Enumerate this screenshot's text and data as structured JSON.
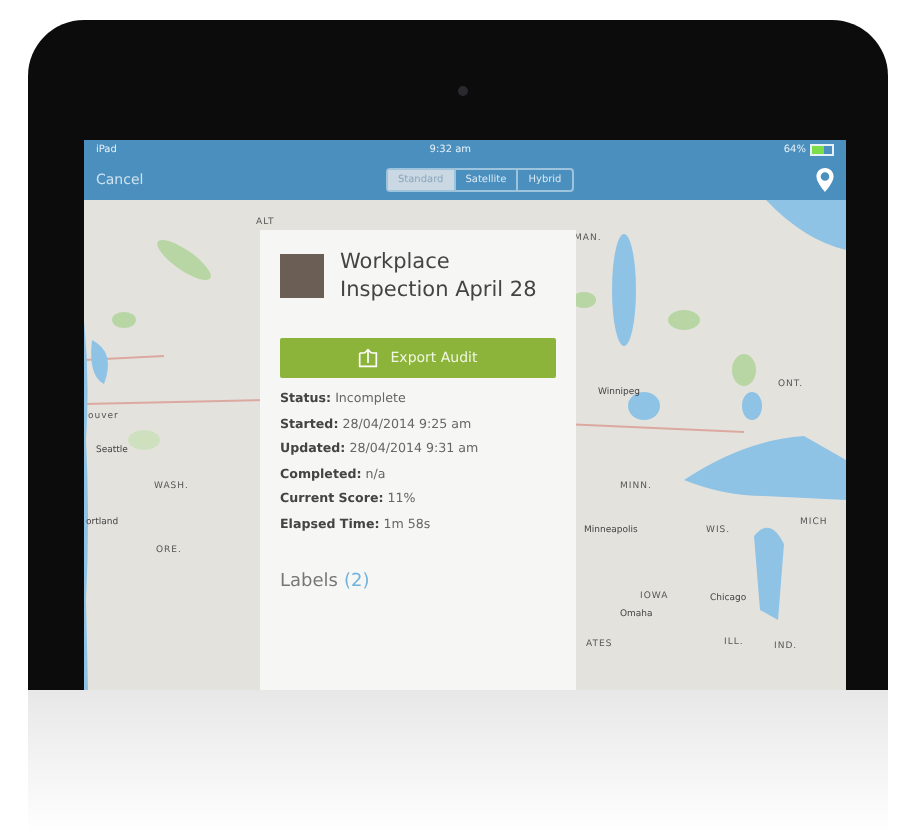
{
  "status_bar": {
    "device": "iPad",
    "time": "9:32 am",
    "battery": "64%"
  },
  "nav_bar": {
    "cancel": "Cancel",
    "segments": [
      {
        "label": "Standard",
        "selected": true
      },
      {
        "label": "Satellite",
        "selected": false
      },
      {
        "label": "Hybrid",
        "selected": false
      }
    ]
  },
  "map": {
    "labels": [
      "ALT",
      "ouver",
      "Seattle",
      "WASH.",
      "ortland",
      "ORE.",
      "MAN.",
      "Winnipeg",
      "ONT.",
      "MINN.",
      "Minneapolis",
      "WIS.",
      "MICH",
      "IOWA",
      "Chicago",
      "Omaha",
      "ATES",
      "ILL.",
      "IND."
    ]
  },
  "audit": {
    "title": "Workplace Inspection April 28",
    "export_button": "Export Audit",
    "fields": [
      {
        "label": "Status:",
        "value": "Incomplete"
      },
      {
        "label": "Started:",
        "value": "28/04/2014 9:25 am"
      },
      {
        "label": "Updated:",
        "value": "28/04/2014 9:31 am"
      },
      {
        "label": "Completed:",
        "value": "n/a"
      },
      {
        "label": "Current Score:",
        "value": "11%"
      },
      {
        "label": "Elapsed Time:",
        "value": "1m 58s"
      }
    ],
    "labels_heading": "Labels",
    "labels_count": "(2)"
  }
}
